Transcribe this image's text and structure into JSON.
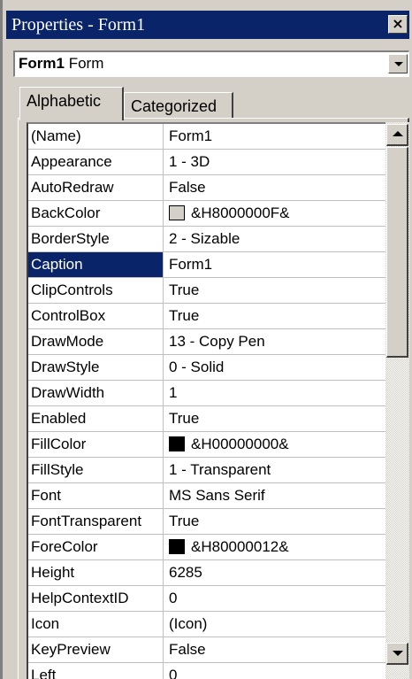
{
  "window": {
    "title": "Properties - Form1",
    "close_label": "×"
  },
  "object_selector": {
    "name": "Form1",
    "type": "Form"
  },
  "tabs": [
    {
      "label": "Alphabetic",
      "active": true
    },
    {
      "label": "Categorized",
      "active": false
    }
  ],
  "properties": [
    {
      "name": "(Name)",
      "value": "Form1"
    },
    {
      "name": "Appearance",
      "value": "1 - 3D"
    },
    {
      "name": "AutoRedraw",
      "value": "False"
    },
    {
      "name": "BackColor",
      "value": "&H8000000F&",
      "swatch": "#d4d0c8"
    },
    {
      "name": "BorderStyle",
      "value": "2 - Sizable"
    },
    {
      "name": "Caption",
      "value": "Form1",
      "selected": true
    },
    {
      "name": "ClipControls",
      "value": "True"
    },
    {
      "name": "ControlBox",
      "value": "True"
    },
    {
      "name": "DrawMode",
      "value": "13 - Copy Pen"
    },
    {
      "name": "DrawStyle",
      "value": "0 - Solid"
    },
    {
      "name": "DrawWidth",
      "value": "1"
    },
    {
      "name": "Enabled",
      "value": "True"
    },
    {
      "name": "FillColor",
      "value": "&H00000000&",
      "swatch": "#000000"
    },
    {
      "name": "FillStyle",
      "value": "1 - Transparent"
    },
    {
      "name": "Font",
      "value": "MS Sans Serif"
    },
    {
      "name": "FontTransparent",
      "value": "True"
    },
    {
      "name": "ForeColor",
      "value": "&H80000012&",
      "swatch": "#000000"
    },
    {
      "name": "Height",
      "value": "6285"
    },
    {
      "name": "HelpContextID",
      "value": "0"
    },
    {
      "name": "Icon",
      "value": "(Icon)"
    },
    {
      "name": "KeyPreview",
      "value": "False"
    },
    {
      "name": "Left",
      "value": "0"
    }
  ],
  "colors": {
    "titlebar": "#0a246a",
    "selection": "#0a246a",
    "chrome": "#d4d0c8"
  }
}
